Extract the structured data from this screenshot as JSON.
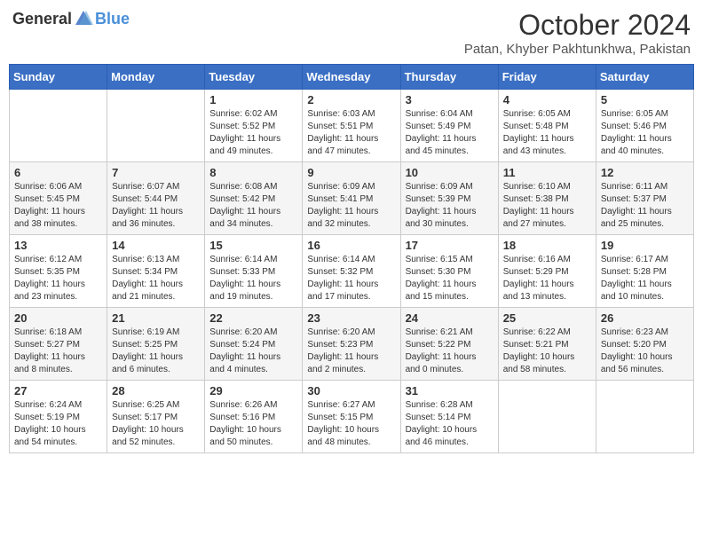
{
  "header": {
    "logo_general": "General",
    "logo_blue": "Blue",
    "month": "October 2024",
    "location": "Patan, Khyber Pakhtunkhwa, Pakistan"
  },
  "weekdays": [
    "Sunday",
    "Monday",
    "Tuesday",
    "Wednesday",
    "Thursday",
    "Friday",
    "Saturday"
  ],
  "weeks": [
    [
      {
        "day": "",
        "detail": ""
      },
      {
        "day": "",
        "detail": ""
      },
      {
        "day": "1",
        "detail": "Sunrise: 6:02 AM\nSunset: 5:52 PM\nDaylight: 11 hours and 49 minutes."
      },
      {
        "day": "2",
        "detail": "Sunrise: 6:03 AM\nSunset: 5:51 PM\nDaylight: 11 hours and 47 minutes."
      },
      {
        "day": "3",
        "detail": "Sunrise: 6:04 AM\nSunset: 5:49 PM\nDaylight: 11 hours and 45 minutes."
      },
      {
        "day": "4",
        "detail": "Sunrise: 6:05 AM\nSunset: 5:48 PM\nDaylight: 11 hours and 43 minutes."
      },
      {
        "day": "5",
        "detail": "Sunrise: 6:05 AM\nSunset: 5:46 PM\nDaylight: 11 hours and 40 minutes."
      }
    ],
    [
      {
        "day": "6",
        "detail": "Sunrise: 6:06 AM\nSunset: 5:45 PM\nDaylight: 11 hours and 38 minutes."
      },
      {
        "day": "7",
        "detail": "Sunrise: 6:07 AM\nSunset: 5:44 PM\nDaylight: 11 hours and 36 minutes."
      },
      {
        "day": "8",
        "detail": "Sunrise: 6:08 AM\nSunset: 5:42 PM\nDaylight: 11 hours and 34 minutes."
      },
      {
        "day": "9",
        "detail": "Sunrise: 6:09 AM\nSunset: 5:41 PM\nDaylight: 11 hours and 32 minutes."
      },
      {
        "day": "10",
        "detail": "Sunrise: 6:09 AM\nSunset: 5:39 PM\nDaylight: 11 hours and 30 minutes."
      },
      {
        "day": "11",
        "detail": "Sunrise: 6:10 AM\nSunset: 5:38 PM\nDaylight: 11 hours and 27 minutes."
      },
      {
        "day": "12",
        "detail": "Sunrise: 6:11 AM\nSunset: 5:37 PM\nDaylight: 11 hours and 25 minutes."
      }
    ],
    [
      {
        "day": "13",
        "detail": "Sunrise: 6:12 AM\nSunset: 5:35 PM\nDaylight: 11 hours and 23 minutes."
      },
      {
        "day": "14",
        "detail": "Sunrise: 6:13 AM\nSunset: 5:34 PM\nDaylight: 11 hours and 21 minutes."
      },
      {
        "day": "15",
        "detail": "Sunrise: 6:14 AM\nSunset: 5:33 PM\nDaylight: 11 hours and 19 minutes."
      },
      {
        "day": "16",
        "detail": "Sunrise: 6:14 AM\nSunset: 5:32 PM\nDaylight: 11 hours and 17 minutes."
      },
      {
        "day": "17",
        "detail": "Sunrise: 6:15 AM\nSunset: 5:30 PM\nDaylight: 11 hours and 15 minutes."
      },
      {
        "day": "18",
        "detail": "Sunrise: 6:16 AM\nSunset: 5:29 PM\nDaylight: 11 hours and 13 minutes."
      },
      {
        "day": "19",
        "detail": "Sunrise: 6:17 AM\nSunset: 5:28 PM\nDaylight: 11 hours and 10 minutes."
      }
    ],
    [
      {
        "day": "20",
        "detail": "Sunrise: 6:18 AM\nSunset: 5:27 PM\nDaylight: 11 hours and 8 minutes."
      },
      {
        "day": "21",
        "detail": "Sunrise: 6:19 AM\nSunset: 5:25 PM\nDaylight: 11 hours and 6 minutes."
      },
      {
        "day": "22",
        "detail": "Sunrise: 6:20 AM\nSunset: 5:24 PM\nDaylight: 11 hours and 4 minutes."
      },
      {
        "day": "23",
        "detail": "Sunrise: 6:20 AM\nSunset: 5:23 PM\nDaylight: 11 hours and 2 minutes."
      },
      {
        "day": "24",
        "detail": "Sunrise: 6:21 AM\nSunset: 5:22 PM\nDaylight: 11 hours and 0 minutes."
      },
      {
        "day": "25",
        "detail": "Sunrise: 6:22 AM\nSunset: 5:21 PM\nDaylight: 10 hours and 58 minutes."
      },
      {
        "day": "26",
        "detail": "Sunrise: 6:23 AM\nSunset: 5:20 PM\nDaylight: 10 hours and 56 minutes."
      }
    ],
    [
      {
        "day": "27",
        "detail": "Sunrise: 6:24 AM\nSunset: 5:19 PM\nDaylight: 10 hours and 54 minutes."
      },
      {
        "day": "28",
        "detail": "Sunrise: 6:25 AM\nSunset: 5:17 PM\nDaylight: 10 hours and 52 minutes."
      },
      {
        "day": "29",
        "detail": "Sunrise: 6:26 AM\nSunset: 5:16 PM\nDaylight: 10 hours and 50 minutes."
      },
      {
        "day": "30",
        "detail": "Sunrise: 6:27 AM\nSunset: 5:15 PM\nDaylight: 10 hours and 48 minutes."
      },
      {
        "day": "31",
        "detail": "Sunrise: 6:28 AM\nSunset: 5:14 PM\nDaylight: 10 hours and 46 minutes."
      },
      {
        "day": "",
        "detail": ""
      },
      {
        "day": "",
        "detail": ""
      }
    ]
  ]
}
